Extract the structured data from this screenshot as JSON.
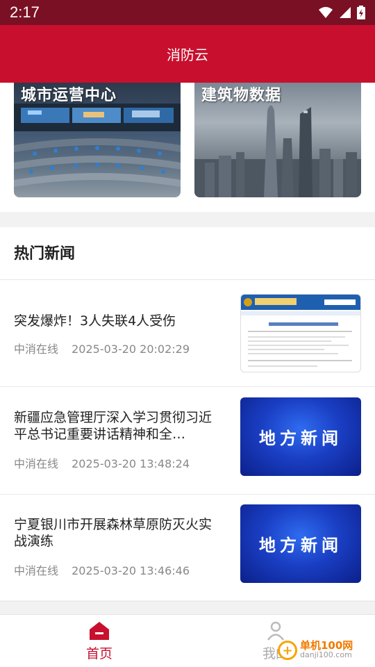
{
  "status_bar": {
    "time": "2:17"
  },
  "app_bar": {
    "title": "消防云"
  },
  "banners": [
    {
      "title": "城市运营中心"
    },
    {
      "title": "建筑物数据"
    }
  ],
  "hot_news": {
    "title": "热门新闻",
    "items": [
      {
        "headline": "突发爆炸！3人失联4人受伤",
        "source": "中消在线",
        "time": "2025-03-20 20:02:29",
        "thumb": "gov-website"
      },
      {
        "headline": "新疆应急管理厅深入学习贯彻习近平总书记重要讲话精神和全…",
        "source": "中消在线",
        "time": "2025-03-20 13:48:24",
        "thumb": "local-news",
        "thumb_text": "地方新闻"
      },
      {
        "headline": "宁夏银川市开展森林草原防灭火实战演练",
        "source": "中消在线",
        "time": "2025-03-20 13:46:46",
        "thumb": "local-news",
        "thumb_text": "地方新闻"
      }
    ]
  },
  "tab_bar": {
    "items": [
      {
        "label": "首页",
        "active": true
      },
      {
        "label": "我的",
        "active": false
      }
    ]
  },
  "watermark": {
    "main": "单机100网",
    "sub": "danji100.com"
  },
  "colors": {
    "primary": "#c8102e",
    "status_bar": "#7a1024"
  }
}
